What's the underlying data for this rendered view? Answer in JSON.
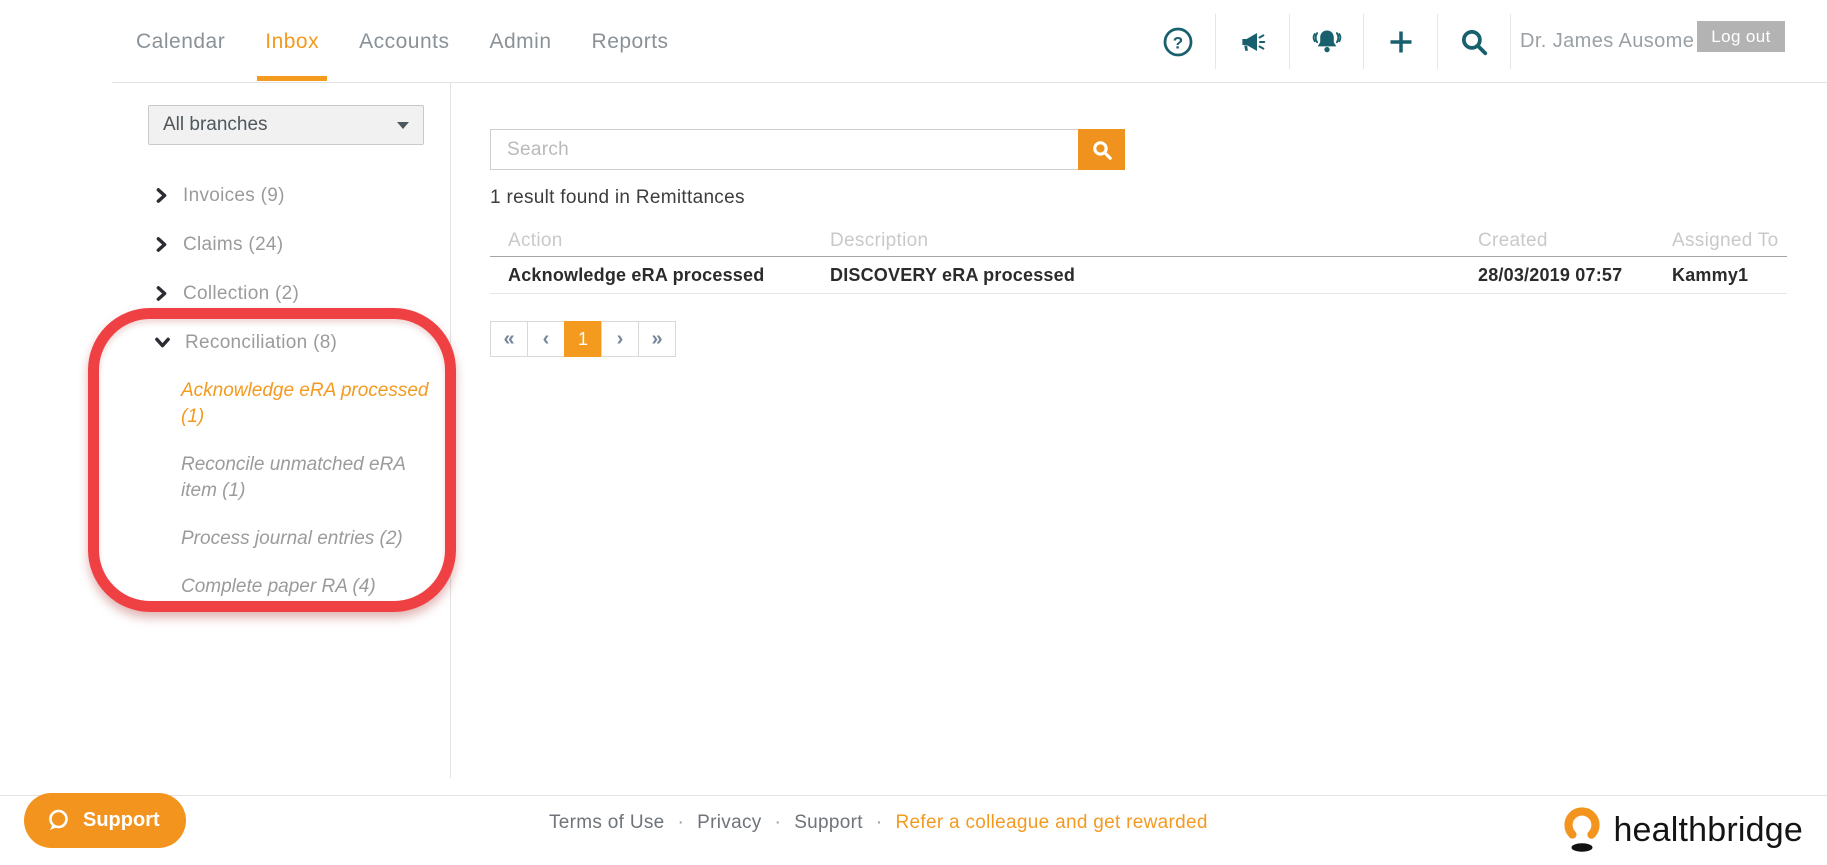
{
  "header": {
    "nav_items": [
      {
        "label": "Calendar",
        "active": false
      },
      {
        "label": "Inbox",
        "active": true
      },
      {
        "label": "Accounts",
        "active": false
      },
      {
        "label": "Admin",
        "active": false
      },
      {
        "label": "Reports",
        "active": false
      }
    ],
    "icons": [
      {
        "name": "help-icon"
      },
      {
        "name": "megaphone-icon"
      },
      {
        "name": "bell-icon"
      },
      {
        "name": "plus-icon"
      },
      {
        "name": "search-icon"
      }
    ],
    "user_name": "Dr. James Ausome",
    "logout_label": "Log out"
  },
  "sidebar": {
    "branch_filter_value": "All branches",
    "tree": [
      {
        "label": "Invoices (9)",
        "expanded": false
      },
      {
        "label": "Claims (24)",
        "expanded": false
      },
      {
        "label": "Collection (2)",
        "expanded": false
      },
      {
        "label": "Reconciliation (8)",
        "expanded": true,
        "children": [
          {
            "label": "Acknowledge eRA processed (1)",
            "active": true
          },
          {
            "label": "Reconcile unmatched eRA item (1)",
            "active": false
          },
          {
            "label": "Process journal entries (2)",
            "active": false
          },
          {
            "label": "Complete paper RA (4)",
            "active": false
          }
        ]
      }
    ]
  },
  "main": {
    "search_placeholder": "Search",
    "result_summary": "1 result found in Remittances",
    "table": {
      "columns": [
        "Action",
        "Description",
        "Created",
        "Assigned To"
      ],
      "rows": [
        {
          "action": "Acknowledge eRA processed",
          "description": "DISCOVERY eRA processed",
          "created": "28/03/2019 07:57",
          "assigned_to": "Kammy1"
        }
      ]
    },
    "pagination": {
      "first_label": "«",
      "prev_label": "‹",
      "page_label": "1",
      "next_label": "›",
      "last_label": "»",
      "current_page": "1"
    }
  },
  "footer": {
    "support_label": "Support",
    "separator": "·",
    "links": [
      {
        "label": "Terms of Use",
        "accent": false
      },
      {
        "label": "Privacy",
        "accent": false
      },
      {
        "label": "Support",
        "accent": false
      },
      {
        "label": "Refer a colleague and get rewarded",
        "accent": true
      }
    ],
    "brand": "healthbridge"
  },
  "colors": {
    "accent_orange": "#f39a1f",
    "icon_teal": "#19606e",
    "annotation_red": "#ef4143",
    "logout_gray": "#b3b3b3"
  }
}
